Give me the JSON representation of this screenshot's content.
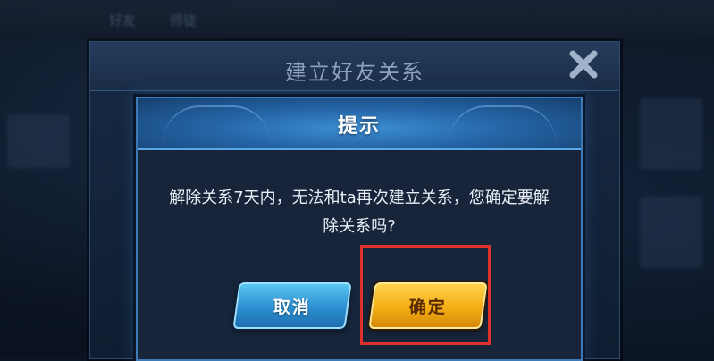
{
  "background": {
    "top_tab_1": "好友",
    "top_tab_2": "师徒"
  },
  "outer_dialog": {
    "title": "建立好友关系",
    "close_icon": "close-x-icon"
  },
  "prompt_dialog": {
    "title": "提示",
    "message_line_1": "解除关系7天内，无法和ta再次建立关系，您确定要解",
    "message_line_2": "除关系吗?",
    "cancel_label": "取消",
    "confirm_label": "确定"
  },
  "colors": {
    "accent_blue": "#3f7ab8",
    "confirm_gold": "#f4ad14",
    "highlight_red": "#e0302a"
  }
}
